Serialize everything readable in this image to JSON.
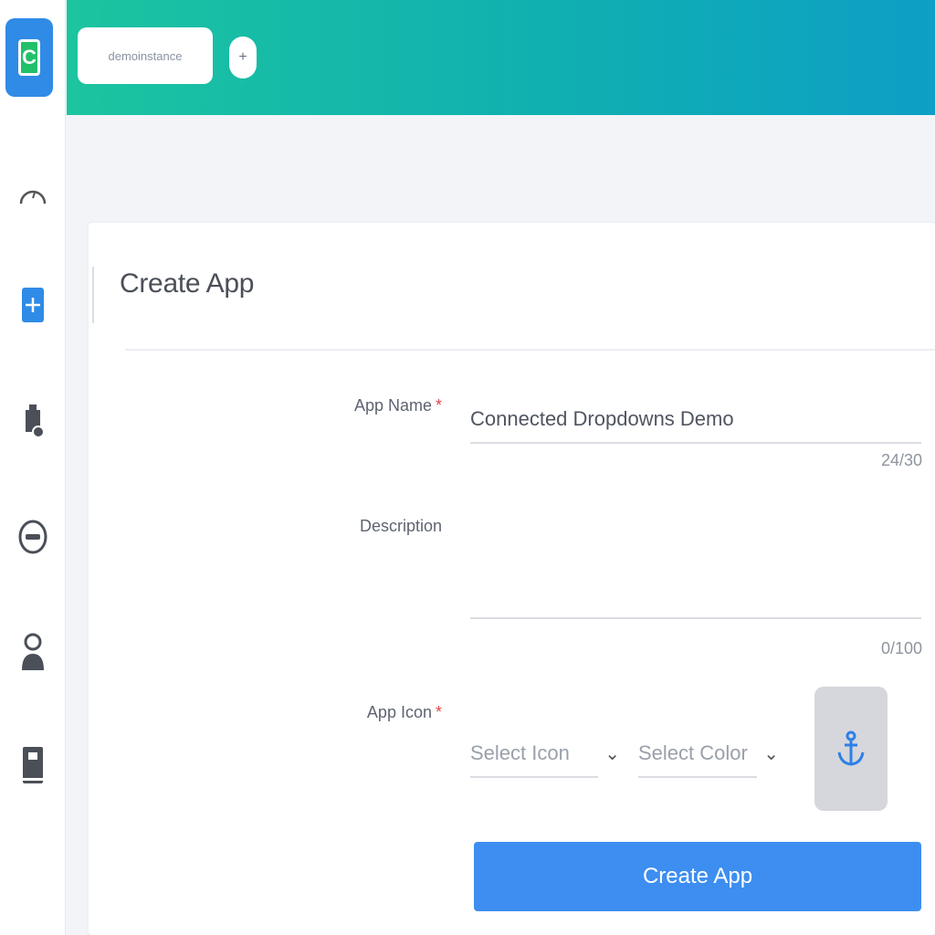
{
  "header": {
    "app_chip_label": "demoinstance"
  },
  "sidebar": {
    "icons": [
      "dashboard-icon",
      "apps-icon",
      "plugins-icon",
      "settings-icon",
      "users-icon",
      "docs-icon"
    ]
  },
  "form": {
    "title": "Create App",
    "app_name_label": "App Name",
    "app_name_value": "Connected Dropdowns Demo",
    "app_name_counter": "24/30",
    "description_label": "Description",
    "description_value": "",
    "description_counter": "0/100",
    "app_icon_label": "App Icon",
    "required_marker": "*",
    "select_icon_placeholder": "Select Icon",
    "select_color_placeholder": "Select Color",
    "preview_icon": "anchor-icon",
    "submit_label": "Create App"
  },
  "colors": {
    "accent": "#3d8ef0",
    "header_start": "#1cc4a0",
    "header_end": "#0d9fc6",
    "required": "#e04848"
  }
}
